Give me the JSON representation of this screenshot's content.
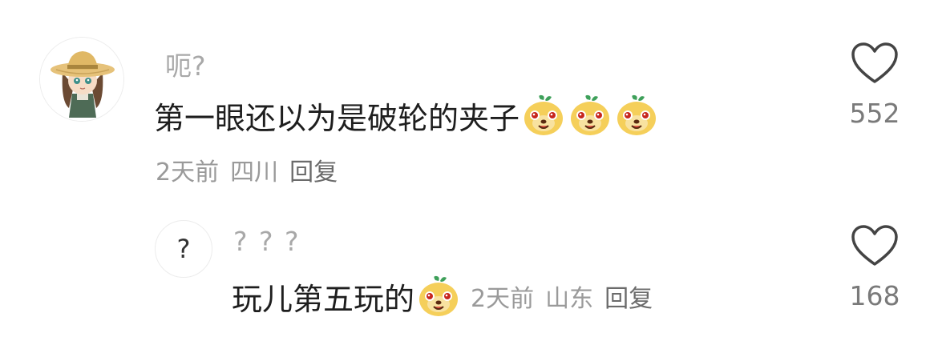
{
  "comments": [
    {
      "username": "呃?",
      "text": "第一眼还以为是破轮的夹子",
      "emoji_count": 3,
      "emoji_icon": "smiling-dog-face-emoji",
      "time": "2天前",
      "location": "四川",
      "reply_label": "回复",
      "likes": "552",
      "avatar_icon": "straw-hat-girl-avatar"
    },
    {
      "username": "? ? ?",
      "avatar_text": "?",
      "text": "玩儿第五玩的",
      "emoji_count": 1,
      "emoji_icon": "smiling-dog-face-emoji",
      "time": "2天前",
      "location": "山东",
      "reply_label": "回复",
      "likes": "168"
    }
  ],
  "colors": {
    "username": "#a8a8a8",
    "text": "#1e1e1e",
    "meta": "#9a9a9a",
    "reply": "#6b6b6b",
    "count": "#7a7a7a"
  }
}
